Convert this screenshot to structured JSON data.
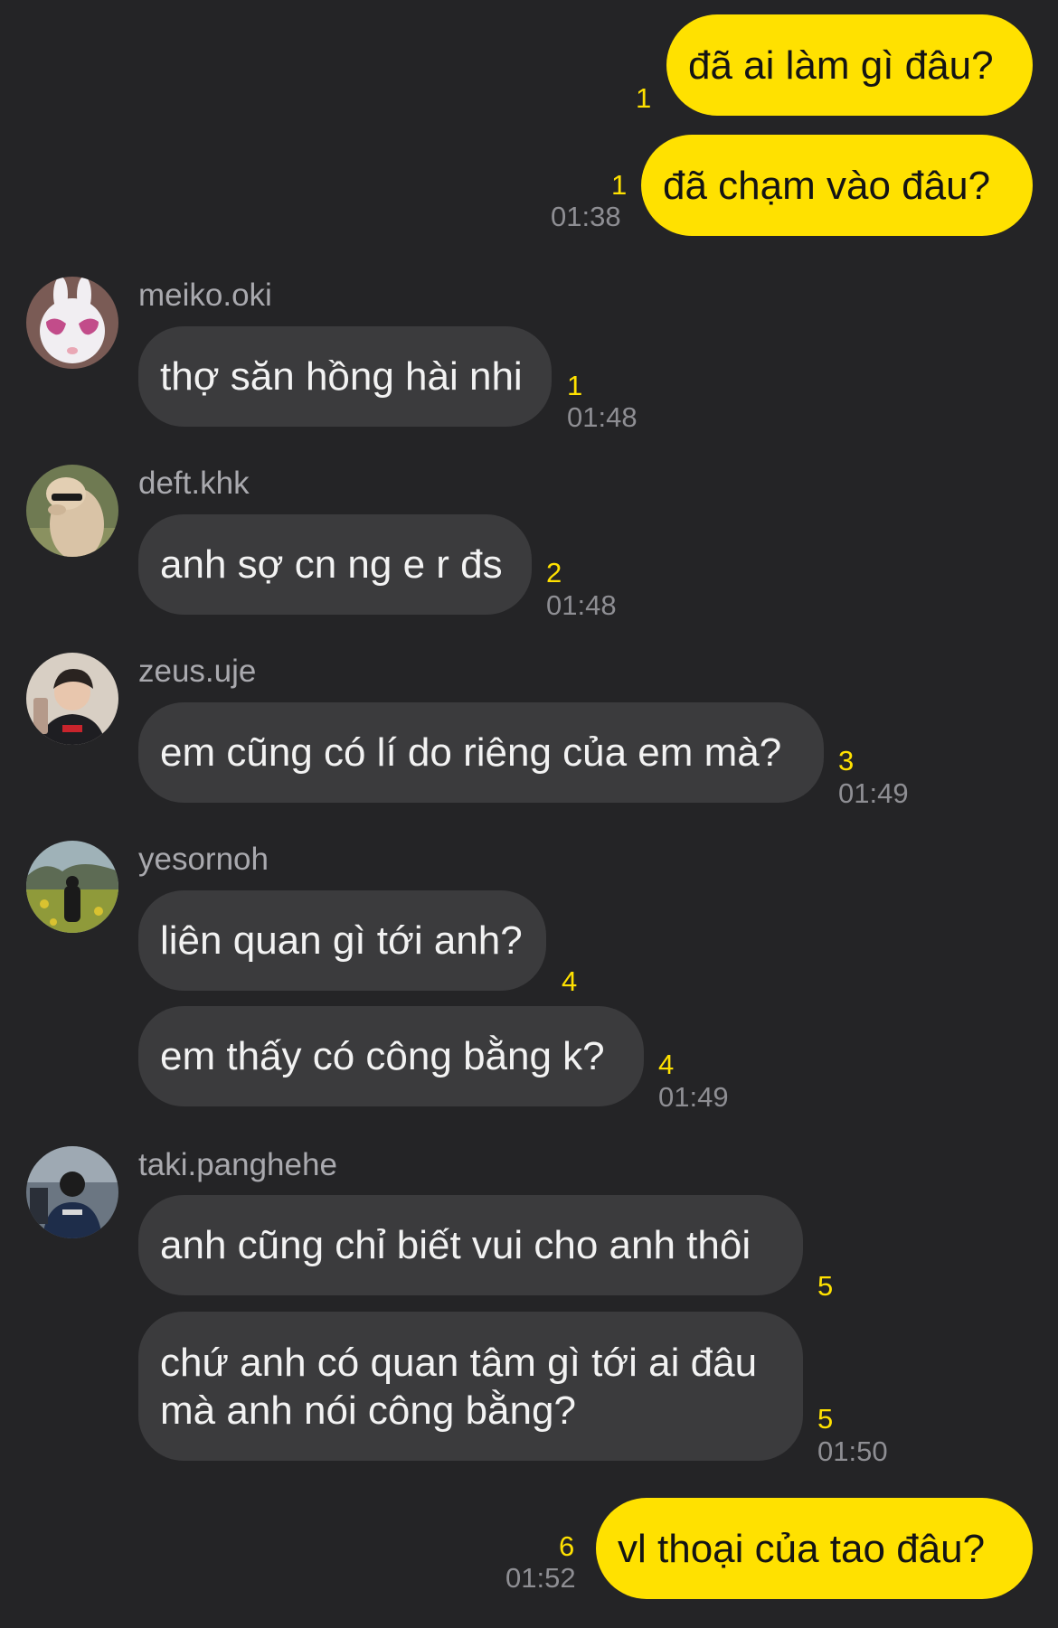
{
  "messages": {
    "out1": {
      "text": "đã ai làm gì đâu?",
      "read": "1"
    },
    "out2": {
      "text": "đã chạm vào đâu?",
      "read": "1",
      "time": "01:38"
    },
    "meiko": {
      "username": "meiko.oki",
      "text": "thợ săn hồng hài nhi",
      "read": "1",
      "time": "01:48"
    },
    "deft": {
      "username": "deft.khk",
      "text": "anh sợ cn ng e r đs",
      "read": "2",
      "time": "01:48"
    },
    "zeus": {
      "username": "zeus.uje",
      "text": "em cũng có lí do riêng của em mà?",
      "read": "3",
      "time": "01:49"
    },
    "yesornoh": {
      "username": "yesornoh",
      "text1": "liên quan gì tới anh?",
      "read1": "4",
      "text2": "em thấy có công bằng k?",
      "read2": "4",
      "time": "01:49"
    },
    "taki": {
      "username": "taki.panghehe",
      "text1": "anh cũng chỉ biết vui cho anh thôi",
      "read1": "5",
      "text2": "chứ anh có quan tâm gì tới ai đâu\nmà anh nói công bằng?",
      "read2": "5",
      "time": "01:50"
    },
    "out3": {
      "text": "vl thoại của tao đâu?",
      "read": "6",
      "time": "01:52"
    }
  },
  "icons": {
    "meiko": "bunny-heart-glasses-avatar",
    "deft": "alpaca-sunglasses-avatar",
    "zeus": "person-selfie-avatar",
    "yesornoh": "person-field-avatar",
    "taki": "person-jersey-avatar"
  },
  "colors": {
    "background": "#242426",
    "outgoing_bubble": "#ffe100",
    "incoming_bubble": "#3b3b3d",
    "read_count": "#ffe100",
    "timestamp": "#8e8e93"
  }
}
